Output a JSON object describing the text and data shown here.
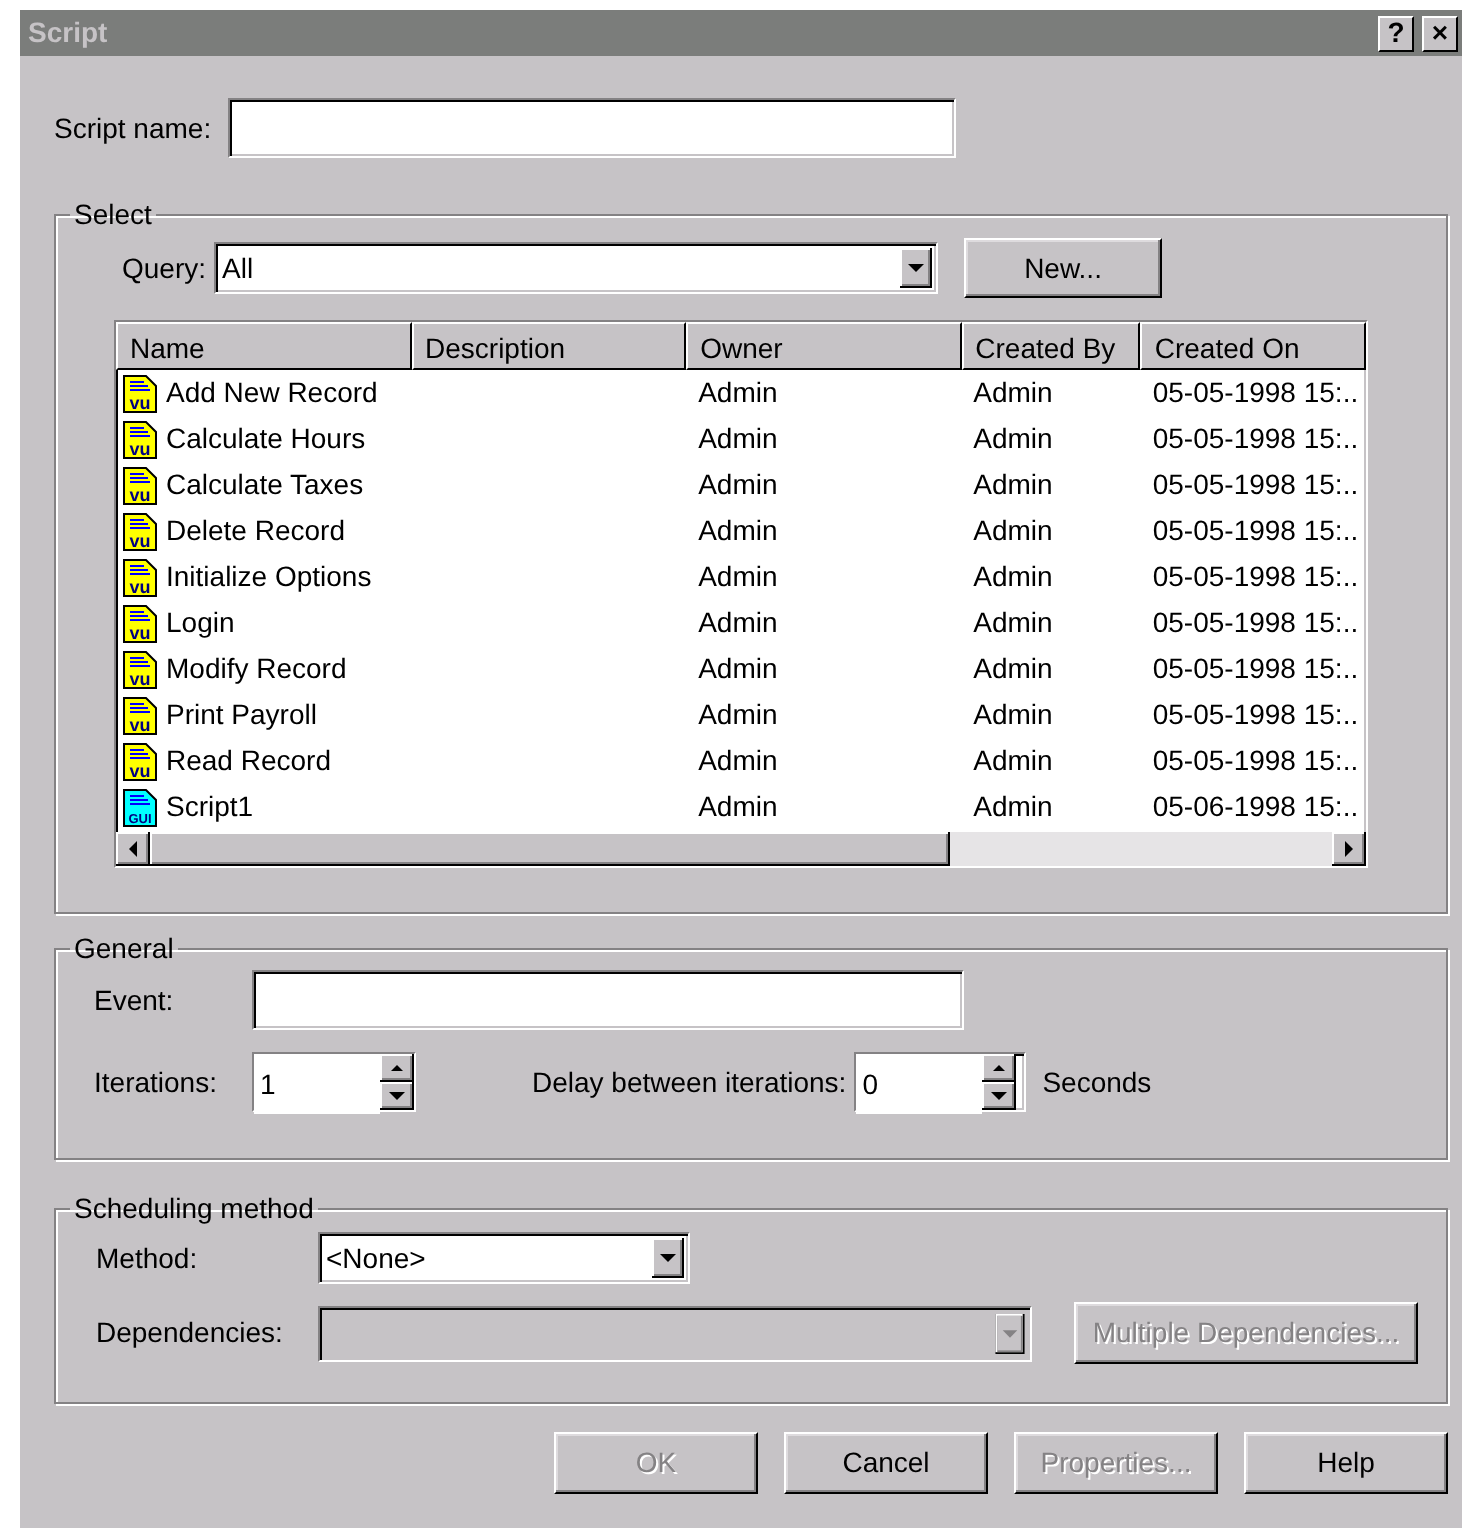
{
  "window": {
    "title": "Script",
    "help_button": "?",
    "close_button": "×"
  },
  "script_name": {
    "label": "Script name:"
  },
  "select": {
    "legend": "Select",
    "query": {
      "label": "Query:",
      "value": "All"
    },
    "new_button": {
      "label": "New...",
      "disabled": false
    },
    "list": {
      "columns": [
        "Name",
        "Description",
        "Owner",
        "Created By",
        "Created On"
      ],
      "rows": [
        {
          "kind": "vu",
          "icon_label": "vu",
          "name": "Add New Record",
          "owner": "Admin",
          "created_by": "Admin",
          "created_on": "05-05-1998 15:.."
        },
        {
          "kind": "vu",
          "icon_label": "vu",
          "name": "Calculate Hours",
          "owner": "Admin",
          "created_by": "Admin",
          "created_on": "05-05-1998 15:.."
        },
        {
          "kind": "vu",
          "icon_label": "vu",
          "name": "Calculate Taxes",
          "owner": "Admin",
          "created_by": "Admin",
          "created_on": "05-05-1998 15:.."
        },
        {
          "kind": "vu",
          "icon_label": "vu",
          "name": "Delete Record",
          "owner": "Admin",
          "created_by": "Admin",
          "created_on": "05-05-1998 15:.."
        },
        {
          "kind": "vu",
          "icon_label": "vu",
          "name": "Initialize Options",
          "owner": "Admin",
          "created_by": "Admin",
          "created_on": "05-05-1998 15:.."
        },
        {
          "kind": "vu",
          "icon_label": "vu",
          "name": "Login",
          "owner": "Admin",
          "created_by": "Admin",
          "created_on": "05-05-1998 15:.."
        },
        {
          "kind": "vu",
          "icon_label": "vu",
          "name": "Modify Record",
          "owner": "Admin",
          "created_by": "Admin",
          "created_on": "05-05-1998 15:.."
        },
        {
          "kind": "vu",
          "icon_label": "vu",
          "name": "Print Payroll",
          "owner": "Admin",
          "created_by": "Admin",
          "created_on": "05-05-1998 15:.."
        },
        {
          "kind": "vu",
          "icon_label": "vu",
          "name": "Read Record",
          "owner": "Admin",
          "created_by": "Admin",
          "created_on": "05-05-1998 15:.."
        },
        {
          "kind": "gui",
          "icon_label": "GUI",
          "name": "Script1",
          "owner": "Admin",
          "created_by": "Admin",
          "created_on": "05-06-1998 15:.."
        }
      ]
    }
  },
  "general": {
    "legend": "General",
    "event": {
      "label": "Event:"
    },
    "iterations": {
      "label": "Iterations:",
      "value": "1"
    },
    "delay": {
      "label": "Delay between iterations:",
      "value": "0",
      "unit": "Seconds"
    }
  },
  "scheduling": {
    "legend": "Scheduling method",
    "method": {
      "label": "Method:",
      "value": "<None>",
      "disabled": false
    },
    "dependencies": {
      "label": "Dependencies:",
      "disabled": true
    },
    "multiple_button": {
      "label": "Multiple Dependencies...",
      "disabled": true
    }
  },
  "buttons": [
    {
      "label": "OK",
      "disabled": true
    },
    {
      "label": "Cancel",
      "disabled": false
    },
    {
      "label": "Properties...",
      "disabled": true
    },
    {
      "label": "Help",
      "disabled": false
    }
  ]
}
